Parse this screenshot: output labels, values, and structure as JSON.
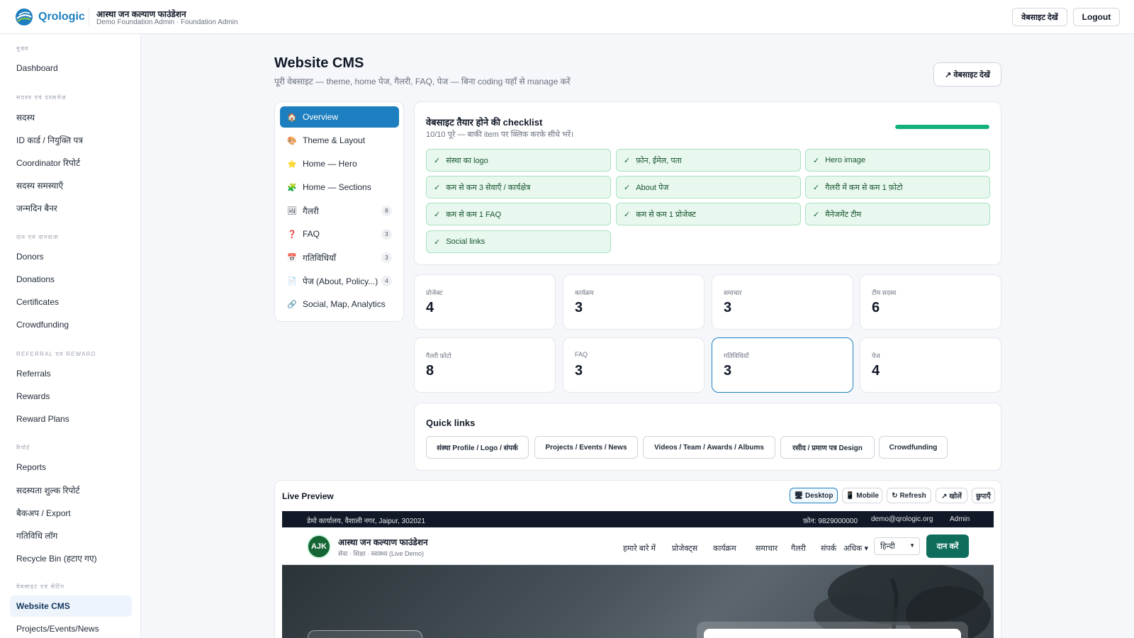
{
  "topbar": {
    "logo_text": "Qrologic",
    "org_name": "आस्था जन कल्याण फाउंडेशन",
    "org_sub": "Demo Foundation Admin · Foundation Admin",
    "view_site": "वेबसाइट देखें",
    "logout": "Logout"
  },
  "sidebar": {
    "sections": [
      "मुख्य",
      "सदस्य एवं दस्तावेज़",
      "दान एवं दानदाता",
      "Referral एवं Reward",
      "रिपोर्ट",
      "वेबसाइट एवं सेटिंग"
    ],
    "items": [
      "Dashboard",
      "सदस्य",
      "ID कार्ड / नियुक्ति पत्र",
      "Coordinator रिपोर्ट",
      "सदस्य समस्याएँ",
      "जन्मदिन बैनर",
      "Donors",
      "Donations",
      "Certificates",
      "Crowdfunding",
      "Referrals",
      "Rewards",
      "Reward Plans",
      "Reports",
      "सदस्यता शुल्क रिपोर्ट",
      "बैकअप / Export",
      "गतिविधि लॉग",
      "Recycle Bin (हटाए गए)",
      "Website CMS",
      "Projects/Events/News"
    ]
  },
  "main": {
    "title": "Website CMS",
    "subtitle": "पूरी वेबसाइट — theme, home पेज, गैलरी, FAQ, पेज — बिना coding यहाँ से manage करें",
    "view_site_btn": "↗ वेबसाइट देखें"
  },
  "cms_nav": [
    {
      "label": "Overview",
      "icon": "home-icon",
      "glyph": "🏠",
      "badge": ""
    },
    {
      "label": "Theme & Layout",
      "icon": "palette-icon",
      "glyph": "🎨",
      "badge": ""
    },
    {
      "label": "Home — Hero",
      "icon": "star-icon",
      "glyph": "⭐",
      "badge": ""
    },
    {
      "label": "Home — Sections",
      "icon": "puzzle-icon",
      "glyph": "🧩",
      "badge": ""
    },
    {
      "label": "गैलरी",
      "icon": "image-icon",
      "glyph": "🖼",
      "badge": "8"
    },
    {
      "label": "FAQ",
      "icon": "question-icon",
      "glyph": "❓",
      "badge": "3"
    },
    {
      "label": "गतिविधियाँ",
      "icon": "calendar-icon",
      "glyph": "📅",
      "badge": "3"
    },
    {
      "label": "पेज (About, Policy...)",
      "icon": "document-icon",
      "glyph": "📄",
      "badge": "4"
    },
    {
      "label": "Social, Map, Analytics",
      "icon": "link-icon",
      "glyph": "🔗",
      "badge": ""
    }
  ],
  "checklist": {
    "title": "वेबसाइट तैयार होने की checklist",
    "subtitle": "10/10 पूरे — बाकी item पर क्लिक करके सीधे भरें।",
    "progress": 1.0,
    "items": [
      "संस्था का logo",
      "फ़ोन, ईमेल, पता",
      "Hero image",
      "कम से कम 3 सेवाएँ / कार्यक्षेत्र",
      "About पेज",
      "गैलरी में कम से कम 1 फ़ोटो",
      "कम से कम 1 FAQ",
      "कम से कम 1 प्रोजेक्ट",
      "मैनेजमेंट टीम",
      "Social links"
    ]
  },
  "stats": [
    {
      "label": "प्रोजेक्ट",
      "value": "4"
    },
    {
      "label": "कार्यक्रम",
      "value": "3"
    },
    {
      "label": "समाचार",
      "value": "3"
    },
    {
      "label": "टीम सदस्य",
      "value": "6"
    },
    {
      "label": "गैलरी फ़ोटो",
      "value": "8"
    },
    {
      "label": "FAQ",
      "value": "3"
    },
    {
      "label": "गतिविधियाँ",
      "value": "3"
    },
    {
      "label": "पेज",
      "value": "4"
    }
  ],
  "quick_links": {
    "title": "Quick links",
    "items": [
      "संस्था Profile / Logo / संपर्क",
      "Projects / Events / News",
      "Videos / Team / Awards / Albums",
      "रसीद / प्रमाण पत्र Design",
      "Crowdfunding"
    ]
  },
  "preview": {
    "title": "Live Preview",
    "buttons": [
      "🖥 Desktop",
      "📱 Mobile",
      "↻ Refresh",
      "↗ खोलें",
      "छुपाएँ"
    ],
    "site": {
      "address": "डेमो कार्यालय, वैशाली नगर, Jaipur, 302021",
      "phone": "फ़ोन: 9829000000",
      "email": "demo@qrologic.org",
      "admin": "Admin",
      "logo_initials": "AJK",
      "name": "आस्था जन कल्याण फाउंडेशन",
      "tagline": "सेवा · शिक्षा · स्वास्थ्य (Live Demo)",
      "nav": [
        "हमारे बारे में",
        "प्रोजेक्ट्स",
        "कार्यक्रम",
        "समाचार",
        "गैलरी",
        "संपर्क",
        "अधिक ▾"
      ],
      "language": "हिन्दी",
      "donate": "दान करें"
    }
  },
  "colors": {
    "accent": "#1d7fbf",
    "success": "#14b07a",
    "donate": "#0f6e5b"
  }
}
